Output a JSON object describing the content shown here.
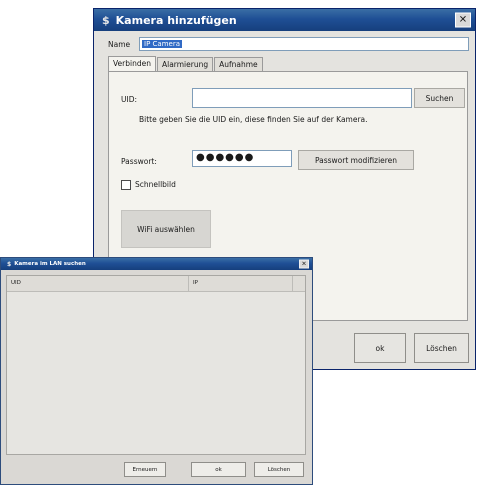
{
  "main_dialog": {
    "title": "Kamera hinzufügen",
    "name_label": "Name",
    "name_value": "IP Camera",
    "tabs": [
      {
        "label": "Verbinden",
        "active": true
      },
      {
        "label": "Alarmierung",
        "active": false
      },
      {
        "label": "Aufnahme",
        "active": false
      }
    ],
    "uid_label": "UID:",
    "uid_value": "",
    "search_button": "Suchen",
    "uid_hint": "Bitte geben Sie die UID ein, diese finden Sie auf der Kamera.",
    "password_label": "Passwort:",
    "password_masked": "●●●●●●",
    "modify_password_button": "Passwort modifizieren",
    "snapshot_checkbox_label": "Schnellbild",
    "snapshot_checked": false,
    "wifi_button": "WiFi auswählen",
    "ok_button": "ok",
    "delete_button": "Löschen",
    "close_glyph": "✕"
  },
  "lan_dialog": {
    "title": "Kamera im LAN suchen",
    "columns": [
      "UID",
      "IP"
    ],
    "rows": [],
    "refresh_button": "Erneuern",
    "ok_button": "ok",
    "delete_button": "Löschen",
    "close_glyph": "✕"
  },
  "icons": {
    "app_icon_glyph": "$"
  },
  "colors": {
    "titlebar": "#1f4f95",
    "window_bg": "#e4e3df",
    "selection": "#316ac5"
  }
}
